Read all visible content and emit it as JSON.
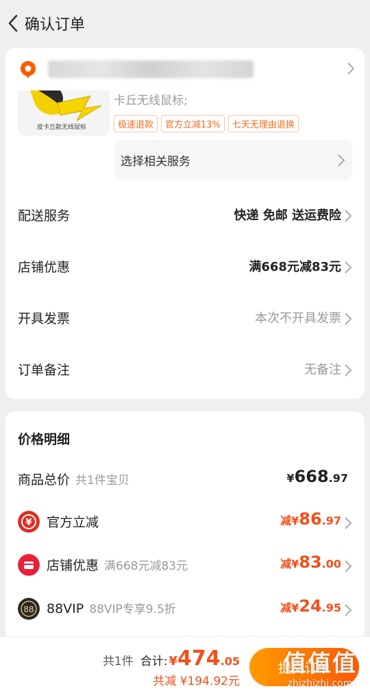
{
  "header": {
    "title": "确认订单"
  },
  "product": {
    "name": "卡丘无线鼠标;",
    "image_label": "皮卡丘款无线鼠标",
    "tags": [
      "极速退款",
      "官方立减13%",
      "七天无理由退换"
    ],
    "service_label": "选择相关服务"
  },
  "rows": [
    {
      "label": "配送服务",
      "value": "快递 免邮 送运费险"
    },
    {
      "label": "店铺优惠",
      "value": "满668元减83元"
    },
    {
      "label": "开具发票",
      "value": "本次不开具发票"
    },
    {
      "label": "订单备注",
      "value": "无备注"
    }
  ],
  "price": {
    "title": "价格明细",
    "total": {
      "label": "商品总价",
      "sub": "共1件宝贝",
      "currency": "¥",
      "int": "668",
      "dec": ".97"
    },
    "items": [
      {
        "label": "官方立减",
        "sub": "",
        "prefix": "减",
        "currency": "¥",
        "int": "86",
        "dec": ".97",
        "icon": "yen-coin-icon",
        "color": "#e02e24"
      },
      {
        "label": "店铺优惠",
        "sub": "满668元减83元",
        "prefix": "减",
        "currency": "¥",
        "int": "83",
        "dec": ".00",
        "icon": "shop-icon",
        "color": "#e8203a"
      },
      {
        "label": "88VIP",
        "sub": "88VIP专享9.5折",
        "prefix": "减",
        "currency": "¥",
        "int": "24",
        "dec": ".95",
        "icon": "88vip-badge-icon",
        "color": "#2a2620"
      }
    ],
    "vip_icon_text": "88"
  },
  "bottom": {
    "count": "共1件",
    "total_label": "合计:",
    "currency": "¥",
    "total_int": "474",
    "total_dec": ".05",
    "saved": "共减 ¥194.92元",
    "submit_label": "提交订单"
  },
  "watermark": {
    "big": "值值值",
    "small": "zhizhizhi.com"
  },
  "colors": {
    "accent": "#f0501c",
    "submit_start": "#ff9a00",
    "submit_end": "#ff5a00"
  }
}
